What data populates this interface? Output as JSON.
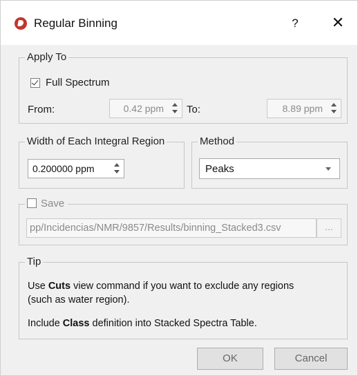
{
  "window": {
    "title": "Regular Binning",
    "help_label": "?",
    "close_label": "✕",
    "icon": "app-logo-icon"
  },
  "apply_to": {
    "legend": "Apply To",
    "full_spectrum_label": "Full Spectrum",
    "full_spectrum_checked": true,
    "from_label": "From:",
    "from_value": "0.42 ppm",
    "to_label": "To:",
    "to_value": "8.89 ppm"
  },
  "width_region": {
    "legend": "Width of Each Integral Region",
    "value": "0.200000 ppm"
  },
  "method": {
    "legend": "Method",
    "selected": "Peaks"
  },
  "save": {
    "label": "Save",
    "checked": false,
    "path": "pp/Incidencias/NMR/9857/Results/binning_Stacked3.csv",
    "browse_label": "..."
  },
  "tip": {
    "legend": "Tip",
    "line1_pre": "Use ",
    "line1_bold": "Cuts",
    "line1_post": " view command if you want to exclude any regions",
    "line2": "(such as water region).",
    "line3_pre": "Include ",
    "line3_bold": "Class",
    "line3_post": " definition into Stacked Spectra Table."
  },
  "buttons": {
    "ok": "OK",
    "cancel": "Cancel"
  },
  "colors": {
    "app_icon": "#c2352b",
    "dialog_bg": "#f0f0f0"
  }
}
